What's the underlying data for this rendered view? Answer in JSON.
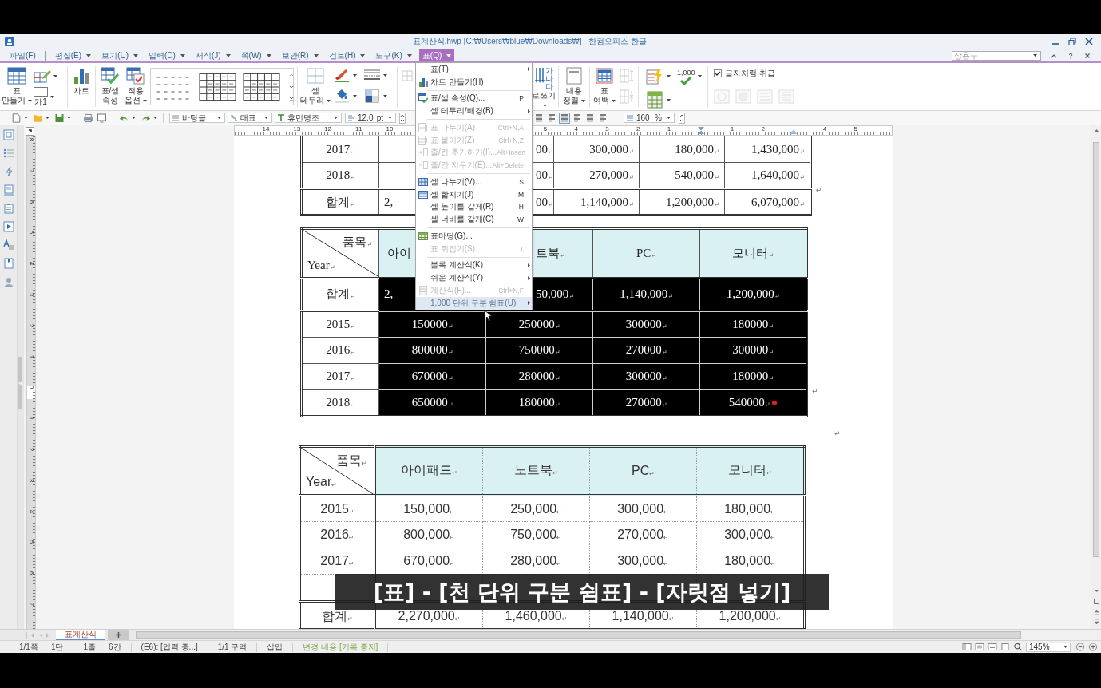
{
  "window": {
    "title": "표계산식.hwp [C:₩Users₩blue₩Downloads₩] - 한컴오피스 한글"
  },
  "menubar": {
    "items": [
      {
        "label": "파일(F)",
        "dropdown": false,
        "selected": false
      },
      {
        "label": "편집(E)",
        "dropdown": true,
        "selected": false
      },
      {
        "label": "보기(U)",
        "dropdown": true,
        "selected": false
      },
      {
        "label": "입력(D)",
        "dropdown": true,
        "selected": false
      },
      {
        "label": "서식(J)",
        "dropdown": true,
        "selected": false
      },
      {
        "label": "쪽(W)",
        "dropdown": true,
        "selected": false
      },
      {
        "label": "보안(R)",
        "dropdown": true,
        "selected": false
      },
      {
        "label": "검토(H)",
        "dropdown": true,
        "selected": false
      },
      {
        "label": "도구(K)",
        "dropdown": true,
        "selected": false
      },
      {
        "label": "표(Q)",
        "dropdown": true,
        "selected": true
      }
    ],
    "phrase_box": {
      "value": "상용구"
    }
  },
  "ribbon": {
    "table_create": {
      "lines": [
        "표",
        "만들기"
      ],
      "dropdown": true
    },
    "caption_tool": {
      "label": "가1",
      "dropdown": true
    },
    "chart": {
      "lines": [
        "차트"
      ]
    },
    "cell_props": {
      "lines": [
        "표/셀",
        "속성"
      ]
    },
    "apply_options": {
      "lines": [
        "적용",
        "옵션"
      ],
      "dropdown": true
    },
    "cell_border": {
      "lines": [
        "셀",
        "테두리"
      ],
      "dropdown": true
    },
    "vertical_text": {
      "icon_text": "가나다",
      "lines": [
        "로쓰기"
      ],
      "dropdown": true
    },
    "content_align": {
      "lines": [
        "내용",
        "정렬"
      ],
      "dropdown": true
    },
    "table_margin": {
      "lines": [
        "표",
        "여백"
      ],
      "dropdown": true
    },
    "thousand_sep": {
      "label": "1,000",
      "dropdown": true
    },
    "treat_as_char": {
      "label": "글자처럼 취급",
      "checked": true
    }
  },
  "format_bar": {
    "style": "바탕글",
    "outline": "대표",
    "font": "휴먼명조",
    "size": {
      "value": "12.0",
      "unit": "pt"
    },
    "align": [
      {
        "selected": false
      },
      {
        "selected": false
      },
      {
        "selected": true
      },
      {
        "selected": false
      },
      {
        "selected": false
      },
      {
        "selected": false
      }
    ],
    "line_spacing": {
      "value": "160",
      "unit": "%"
    }
  },
  "rulers": {
    "horizontal": [
      [
        "14",
        "13",
        "12",
        "11",
        "10"
      ],
      [
        "5",
        "4",
        "3",
        "2",
        "1"
      ],
      [
        "1",
        "2"
      ],
      [
        "4",
        "5"
      ]
    ],
    "vertical": [
      "8",
      "7",
      "6",
      "5",
      "4",
      "3",
      "2",
      "1",
      "0",
      "1",
      "2",
      "3",
      "4",
      "5",
      "6",
      "7"
    ]
  },
  "table_menu": {
    "items": [
      {
        "kind": "item",
        "label": "표(T)",
        "submenu": true,
        "disabled": false,
        "selected": false
      },
      {
        "kind": "item",
        "label": "차트 만들기(H)",
        "submenu": false,
        "disabled": false,
        "selected": false
      },
      {
        "kind": "separator"
      },
      {
        "kind": "item",
        "label": "표/셀 속성(Q)...",
        "key": "P",
        "submenu": false,
        "disabled": false,
        "selected": false
      },
      {
        "kind": "item",
        "label": "셀 테두리/배경(B)",
        "submenu": true,
        "disabled": false,
        "selected": false
      },
      {
        "kind": "separator"
      },
      {
        "kind": "item",
        "label": "표 나누기(A)",
        "key": "Ctrl+N,A",
        "submenu": false,
        "disabled": true,
        "selected": false
      },
      {
        "kind": "item",
        "label": "표 붙이기(Z)",
        "key": "Ctrl+N,Z",
        "submenu": false,
        "disabled": true,
        "selected": false
      },
      {
        "kind": "item",
        "label": "줄/칸 추가하기(I)...",
        "key": "Alt+Insert",
        "submenu": false,
        "disabled": true,
        "selected": false
      },
      {
        "kind": "item",
        "label": "줄/칸 지우기(E)...",
        "key": "Alt+Delete",
        "submenu": false,
        "disabled": true,
        "selected": false
      },
      {
        "kind": "separator"
      },
      {
        "kind": "item",
        "label": "셀 나누기(V)...",
        "key": "S",
        "submenu": false,
        "disabled": false,
        "selected": false
      },
      {
        "kind": "item",
        "label": "셀 합치기(J)",
        "key": "M",
        "submenu": false,
        "disabled": false,
        "selected": false
      },
      {
        "kind": "item",
        "label": "셀 높이를 같게(R)",
        "key": "H",
        "submenu": false,
        "disabled": false,
        "selected": false
      },
      {
        "kind": "item",
        "label": "셀 너비를 같게(C)",
        "key": "W",
        "submenu": false,
        "disabled": false,
        "selected": false
      },
      {
        "kind": "separator"
      },
      {
        "kind": "item",
        "label": "표마당(G)...",
        "submenu": false,
        "disabled": false,
        "selected": false
      },
      {
        "kind": "item",
        "label": "표 뒤집기(S)...",
        "key": "T",
        "submenu": false,
        "disabled": true,
        "selected": false
      },
      {
        "kind": "separator"
      },
      {
        "kind": "item",
        "label": "블록 계산식(K)",
        "submenu": true,
        "disabled": false,
        "selected": false
      },
      {
        "kind": "item",
        "label": "쉬운 계산식(Y)",
        "submenu": true,
        "disabled": false,
        "selected": false
      },
      {
        "kind": "item",
        "label": "계산식(F)...",
        "key": "Ctrl+N,F",
        "submenu": false,
        "disabled": true,
        "selected": false
      },
      {
        "kind": "item",
        "label": "1,000 단위 구분 쉼표(U)",
        "submenu": true,
        "disabled": false,
        "selected": true
      }
    ]
  },
  "document": {
    "blocks": [
      {
        "kind": "table",
        "mark": "↵",
        "rows": [
          {
            "kind": "data",
            "year": "2017$_{↵}$",
            "cells": [
              "",
              "00$_{↵}$",
              "300,000$_{↵}$",
              "180,000$_{↵}$",
              "1,430,000$_{↵}$"
            ],
            "selected": false
          },
          {
            "kind": "data",
            "year": "2018$_{↵}$",
            "cells": [
              "",
              "00$_{↵}$",
              "270,000$_{↵}$",
              "540,000$_{↵}$",
              "1,640,000$_{↵}$"
            ],
            "selected": false
          },
          {
            "kind": "total",
            "year": "합계$_{↵}$",
            "cells": [
              "2,",
              "00$_{↵}$",
              "1,140,000$_{↵}$",
              "1,200,000$_{↵}$",
              "6,070,000$_{↵}$"
            ],
            "selected": false
          }
        ]
      },
      {
        "kind": "table",
        "mark": "↵",
        "header": {
          "corner": {
            "top": "품목$_{↵}$",
            "bottom": "Year$_{↵}$"
          },
          "cells": [
            "아이",
            "트북$_{↵}$",
            "PC$_{↵}$",
            "모니터$_{↵}$"
          ]
        },
        "rows": [
          {
            "kind": "total",
            "year": "합계$_{↵}$",
            "cells": [
              "2,",
              "50,000$_{↵}$",
              "1,140,000$_{↵}$",
              "1,200,000$_{↵}$"
            ],
            "selected": true
          },
          {
            "kind": "data",
            "year": "2015$_{↵}$",
            "cells": [
              "150000$_{↵}$",
              "250000$_{↵}$",
              "300000$_{↵}$",
              "180000$_{↵}$"
            ],
            "selected": true
          },
          {
            "kind": "data",
            "year": "2016$_{↵}$",
            "cells": [
              "800000$_{↵}$",
              "750000$_{↵}$",
              "270000$_{↵}$",
              "300000$_{↵}$"
            ],
            "selected": true
          },
          {
            "kind": "data",
            "year": "2017$_{↵}$",
            "cells": [
              "670000$_{↵}$",
              "280000$_{↵}$",
              "300000$_{↵}$",
              "180000$_{↵}$"
            ],
            "selected": true
          },
          {
            "kind": "data",
            "year": "2018$_{↵}$",
            "cells": [
              "650000$_{↵}$",
              "180000$_{↵}$",
              "270000$_{↵}$",
              {
                "text": "540000$_{↵}$",
                "caret": true
              }
            ],
            "selected": true
          }
        ]
      },
      {
        "kind": "para",
        "mark": "↵"
      },
      {
        "kind": "table",
        "header": {
          "corner": {
            "top": "품목$_{↵}$",
            "bottom": "Year$_{↵}$"
          },
          "cells": [
            "아이패드$_{↵}$",
            "노트북$_{↵}$",
            "PC$_{↵}$",
            "모니터$_{↵}$"
          ]
        },
        "rows": [
          {
            "kind": "data",
            "year": "2015$_{↵}$",
            "cells": [
              "150,000$_{↵}$",
              "250,000$_{↵}$",
              "300,000$_{↵}$",
              "180,000$_{↵}$"
            ],
            "selected": false
          },
          {
            "kind": "data",
            "year": "2016$_{↵}$",
            "cells": [
              "800,000$_{↵}$",
              "750,000$_{↵}$",
              "270,000$_{↵}$",
              "300,000$_{↵}$"
            ],
            "selected": false
          },
          {
            "kind": "data",
            "year": "2017$_{↵}$",
            "cells": [
              "670,000$_{↵}$",
              "280,000$_{↵}$",
              "300,000$_{↵}$",
              "180,000$_{↵}$"
            ],
            "selected": false
          },
          {
            "kind": "covered"
          },
          {
            "kind": "total",
            "year": "합계$_{↵}$",
            "cells": [
              "2,270,000$_{↵}$",
              "1,460,000$_{↵}$",
              "1,140,000$_{↵}$",
              "1,200,000$_{↵}$"
            ],
            "selected": false
          }
        ]
      }
    ]
  },
  "sheet_tabs": [
    {
      "label": "표계산식",
      "selected": true
    }
  ],
  "status_bar": {
    "groups": [
      {
        "kind": "info",
        "texts": [
          "1/1쪽",
          "1단"
        ]
      },
      {
        "kind": "info",
        "texts": [
          "1줄",
          "6칸"
        ]
      },
      {
        "kind": "info",
        "texts": [
          "(E6): [입력 중...]"
        ]
      },
      {
        "kind": "info",
        "texts": [
          "1/1 구역"
        ]
      },
      {
        "kind": "info",
        "texts": [
          "삽입"
        ]
      },
      {
        "kind": "tracking",
        "texts": [
          "변경 내용 [기록 중지]"
        ]
      }
    ],
    "zoom": "145%"
  },
  "caption": "[표] - [천 단위 구분 쉼표] - [자릿점 넣기]"
}
